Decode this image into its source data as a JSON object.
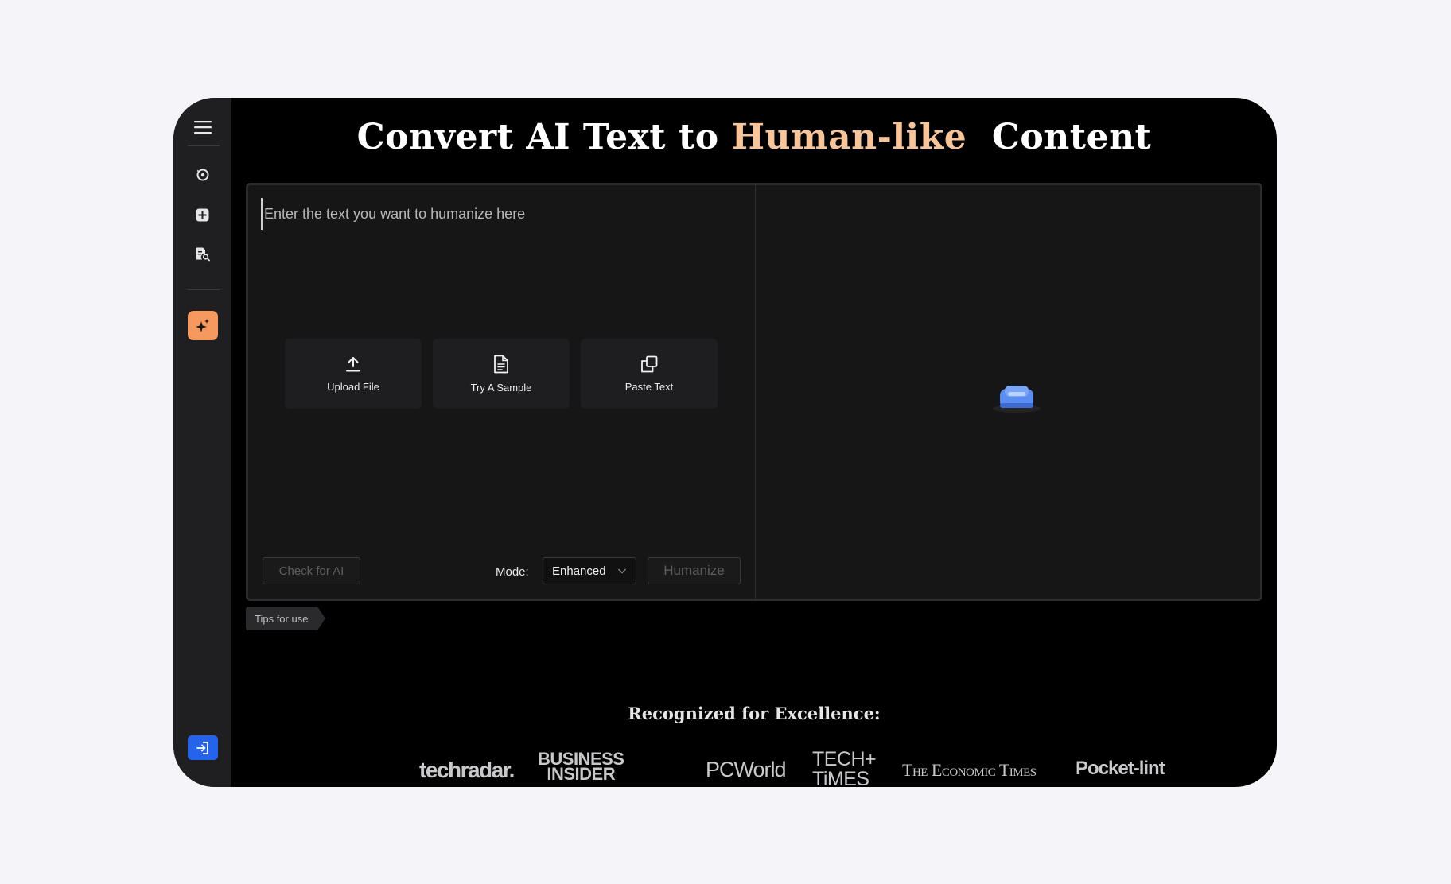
{
  "header": {
    "title_prefix": "Convert AI Text to",
    "title_accent": "Human-like",
    "title_suffix": "Content"
  },
  "sidebar": {
    "items": [
      {
        "icon": "menu-icon"
      },
      {
        "icon": "history-icon"
      },
      {
        "icon": "add-icon"
      },
      {
        "icon": "document-search-icon"
      },
      {
        "icon": "sparkle-icon",
        "active": true,
        "color": "#f5995e"
      },
      {
        "icon": "login-icon",
        "color": "#2563eb"
      }
    ]
  },
  "editor": {
    "input_placeholder": "Enter the text you want to humanize here",
    "actions": [
      {
        "label": "Upload File",
        "icon": "upload-icon"
      },
      {
        "label": "Try A Sample",
        "icon": "document-icon"
      },
      {
        "label": "Paste Text",
        "icon": "copy-icon"
      }
    ],
    "check_label": "Check for AI",
    "mode_label": "Mode:",
    "mode_value": "Enhanced",
    "humanize_label": "Humanize"
  },
  "tips_label": "Tips for use",
  "recognized": {
    "heading": "Recognized for Excellence:",
    "logos": {
      "techradar": "techradar.",
      "bi_line1": "BUSINESS",
      "bi_line2": "INSIDER",
      "pcworld": "PCWorld",
      "techtimes_line1": "TECH+",
      "techtimes_line2": "TiMES",
      "economic_times": "The Economic Times",
      "pocketlint": "Pocket-lint"
    }
  },
  "colors": {
    "accent": "#f8c59a",
    "sparkle_button": "#f5995e",
    "login_button": "#2563eb",
    "background": "#f5f5f9"
  }
}
